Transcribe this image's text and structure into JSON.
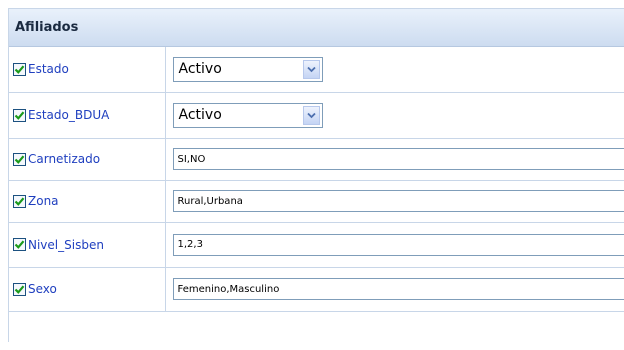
{
  "panel": {
    "title": "Afiliados"
  },
  "rows": [
    {
      "label": "Estado",
      "checked": true,
      "control": "select",
      "value": "Activo"
    },
    {
      "label": "Estado_BDUA",
      "checked": true,
      "control": "select",
      "value": "Activo"
    },
    {
      "label": "Carnetizado",
      "checked": true,
      "control": "text",
      "value": "SI,NO"
    },
    {
      "label": "Zona",
      "checked": true,
      "control": "text",
      "value": "Rural,Urbana"
    },
    {
      "label": "Nivel_Sisben",
      "checked": true,
      "control": "text",
      "value": "1,2,3"
    },
    {
      "label": "Sexo",
      "checked": true,
      "control": "text",
      "value": "Femenino,Masculino"
    }
  ],
  "icons": {
    "checkbox": "checkmark-icon",
    "dropdown": "chevron-down-icon"
  },
  "colors": {
    "header_bg": "#cddcf0",
    "label_text": "#1f3fbf",
    "grid_line": "#c8d6e8",
    "check_mark": "#1a9a1a"
  }
}
